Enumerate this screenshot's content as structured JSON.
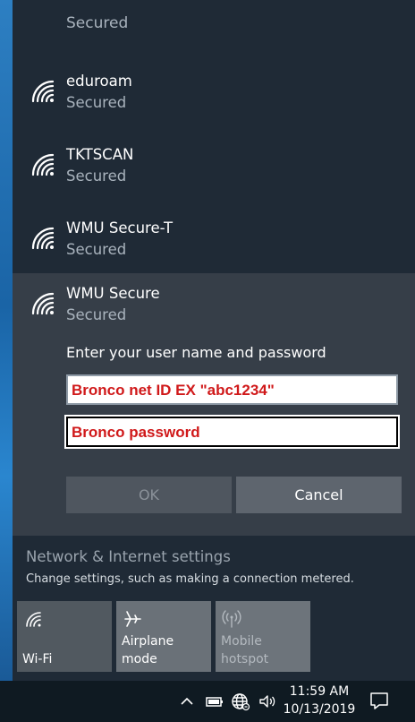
{
  "networks": {
    "partial_status": "Secured",
    "items": [
      {
        "name": "eduroam",
        "status": "Secured"
      },
      {
        "name": "TKTSCAN",
        "status": "Secured"
      },
      {
        "name": "WMU Secure-T",
        "status": "Secured"
      }
    ],
    "selected": {
      "name": "WMU Secure",
      "status": "Secured",
      "prompt": "Enter your user name and password",
      "username_value": "Bronco net ID EX \"abc1234\"",
      "password_value": "Bronco password",
      "ok_label": "OK",
      "cancel_label": "Cancel"
    }
  },
  "settings": {
    "link": "Network & Internet settings",
    "description": "Change settings, such as making a connection metered."
  },
  "quick_actions": [
    {
      "label": "Wi-Fi",
      "icon": "wifi-icon"
    },
    {
      "label": "Airplane mode",
      "icon": "airplane-icon"
    },
    {
      "label": "Mobile\nhotspot",
      "icon": "hotspot-icon"
    }
  ],
  "taskbar": {
    "time": "11:59 AM",
    "date": "10/13/2019",
    "tray_icons": [
      "chevron-up-icon",
      "battery-icon",
      "globe-network-icon",
      "volume-icon",
      "notification-icon"
    ]
  },
  "colors": {
    "flyout_bg": "#1f2a36",
    "selected_bg": "#363e48",
    "annotation_red": "#d0191a"
  }
}
